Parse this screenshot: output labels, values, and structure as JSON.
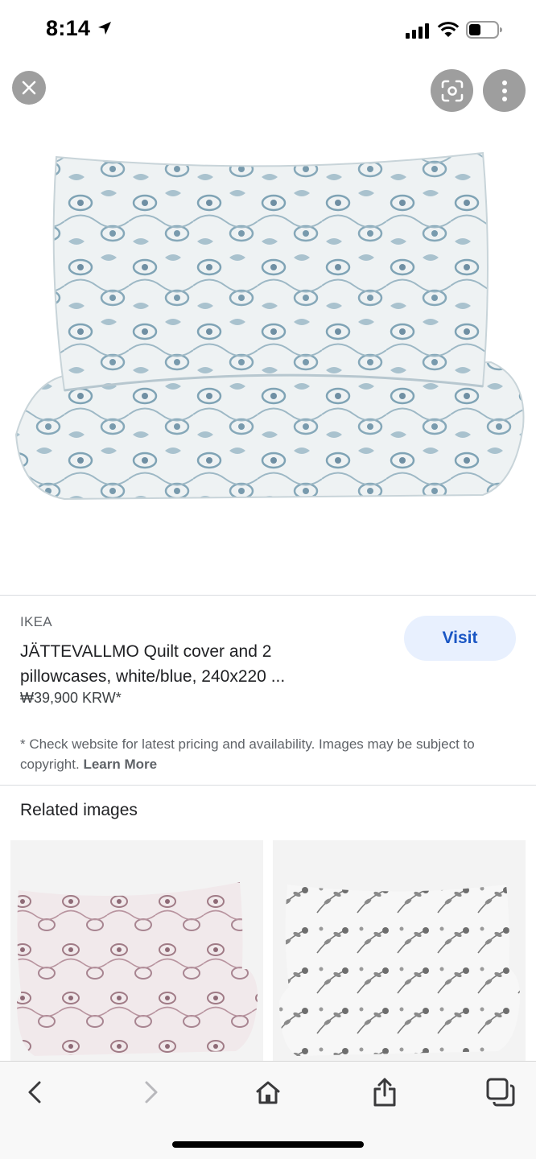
{
  "status_bar": {
    "time": "8:14"
  },
  "result": {
    "source": "IKEA",
    "title": "JÄTTEVALLMO Quilt cover and 2 pillowcases, white/blue, 240x220 ...",
    "price": "₩39,900 KRW*",
    "visit_label": "Visit",
    "disclaimer": "* Check website for latest pricing and availability. Images may be subject to copyright.",
    "learn_more": "Learn More"
  },
  "related": {
    "heading": "Related images"
  },
  "colors": {
    "accent": "#1a56c4",
    "visit_bg": "#e8f0fe",
    "pattern_blue": "#7fa3b5",
    "pattern_mauve": "#a07b86",
    "pattern_grey": "#7a7a7a"
  },
  "icons": [
    "location-arrow-icon",
    "signal-icon",
    "wifi-icon",
    "battery-icon",
    "close-icon",
    "lens-icon",
    "more-vert-icon",
    "back-icon",
    "forward-icon",
    "home-icon",
    "share-icon",
    "tabs-icon"
  ]
}
